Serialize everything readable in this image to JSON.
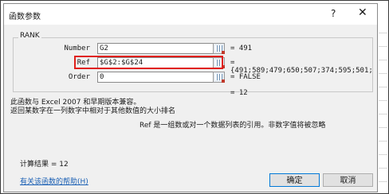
{
  "dialog": {
    "title": "函数参数",
    "help_glyph": "?",
    "close_glyph": "✕"
  },
  "function_name": "RANK",
  "args": [
    {
      "label": "Number",
      "value": "G2",
      "result": "= 491"
    },
    {
      "label": "Ref",
      "value": "$G$2:$G$24",
      "result": "= {491;589;479;650;507;374;595;501;"
    },
    {
      "label": "Order",
      "value": "0",
      "result": "= FALSE"
    }
  ],
  "formula_result": "= 12",
  "description": {
    "line1": "此函数与 Excel 2007 和早期版本兼容。",
    "line2": "返回某数字在一列数字中相对于其他数值的大小排名"
  },
  "param_description": "Ref  是一组数或对一个数据列表的引用。非数字值将被忽略",
  "calc_result": "计算结果 = 12",
  "help_link": "有关该函数的帮助(H)",
  "buttons": {
    "ok": "确定",
    "cancel": "取消"
  },
  "colors": {
    "highlight": "#e0201b",
    "link": "#1a5fb4"
  },
  "icons": {
    "ref_button": "range-select-icon"
  }
}
